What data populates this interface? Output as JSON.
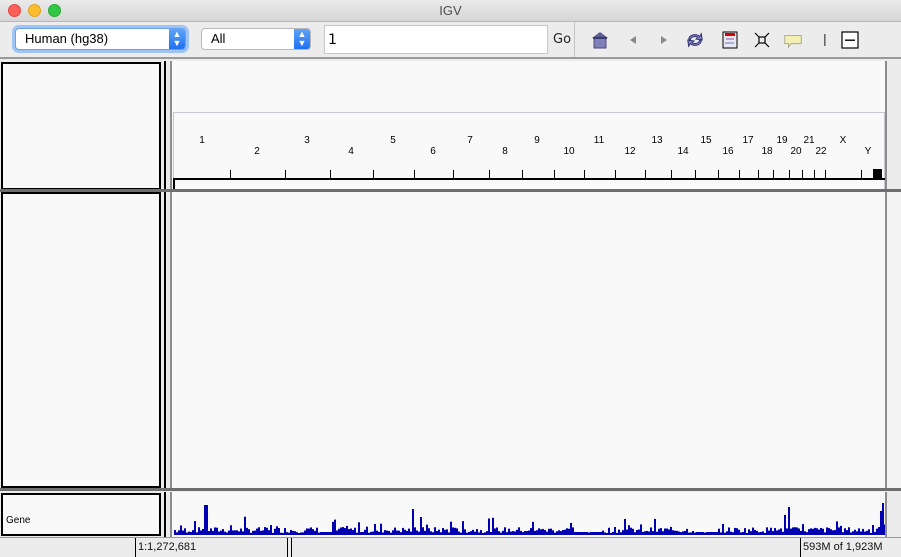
{
  "window": {
    "title": "IGV"
  },
  "toolbar": {
    "genome_select": "Human (hg38)",
    "chromosome_select": "All",
    "locus_input": "1",
    "go_label": "Go",
    "icons": [
      "home-icon",
      "back-arrow-icon",
      "forward-arrow-icon",
      "refresh-icon",
      "region-of-interest-icon",
      "resize-to-window-icon",
      "popup-info-icon",
      "center-line-icon",
      "zoom-out-icon"
    ]
  },
  "ruler": {
    "chromosomes": [
      {
        "name": "1",
        "row": "top"
      },
      {
        "name": "2",
        "row": "bottom"
      },
      {
        "name": "3",
        "row": "top"
      },
      {
        "name": "4",
        "row": "bottom"
      },
      {
        "name": "5",
        "row": "top"
      },
      {
        "name": "6",
        "row": "bottom"
      },
      {
        "name": "7",
        "row": "top"
      },
      {
        "name": "8",
        "row": "bottom"
      },
      {
        "name": "9",
        "row": "top"
      },
      {
        "name": "10",
        "row": "bottom"
      },
      {
        "name": "11",
        "row": "top"
      },
      {
        "name": "12",
        "row": "bottom"
      },
      {
        "name": "13",
        "row": "top"
      },
      {
        "name": "14",
        "row": "bottom"
      },
      {
        "name": "15",
        "row": "top"
      },
      {
        "name": "16",
        "row": "bottom"
      },
      {
        "name": "17",
        "row": "top"
      },
      {
        "name": "18",
        "row": "bottom"
      },
      {
        "name": "19",
        "row": "top"
      },
      {
        "name": "20",
        "row": "bottom"
      },
      {
        "name": "21",
        "row": "top"
      },
      {
        "name": "22",
        "row": "bottom"
      },
      {
        "name": "X",
        "row": "top"
      },
      {
        "name": "Y",
        "row": "bottom"
      }
    ]
  },
  "tracks": {
    "gene": {
      "name": "Gene",
      "color": "#0000b2"
    }
  },
  "status": {
    "position": "1:1,272,681",
    "memory": "593M of 1,923M"
  }
}
